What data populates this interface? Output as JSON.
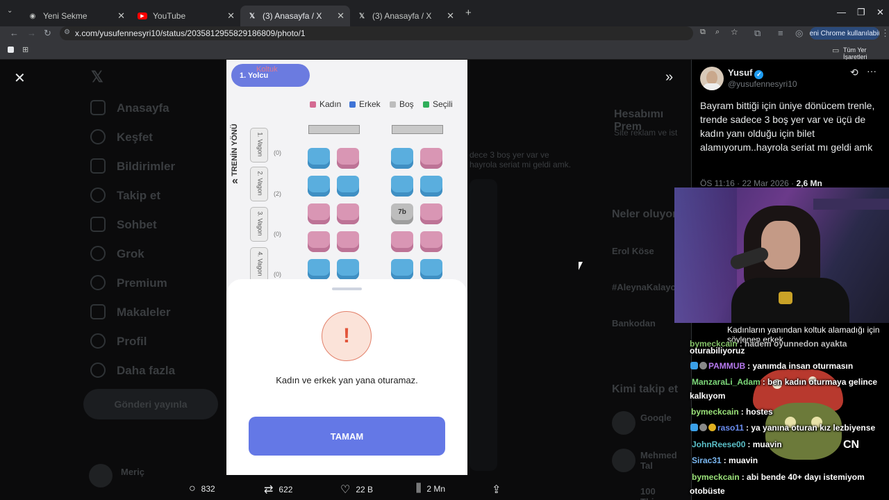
{
  "browser": {
    "tabs": [
      {
        "label": "Yeni Sekme",
        "active": false
      },
      {
        "label": "YouTube",
        "active": false
      },
      {
        "label": "(3) Anasayfa / X",
        "active": true
      },
      {
        "label": "(3) Anasayfa / X",
        "active": false
      }
    ],
    "url": "x.com/yusufennesyri10/status/2035812955829186809/photo/1",
    "chrome_button": "Yeni Chrome kullanılabilir",
    "bookmarks_label": "Tüm Yer İşaretleri"
  },
  "x_sidebar": {
    "items": [
      "Anasayfa",
      "Keşfet",
      "Bildirimler",
      "Takip et",
      "Sohbet",
      "Grok",
      "Premium",
      "Makaleler",
      "Profil",
      "Daha fazla"
    ],
    "post_button": "Gönderi yayınla",
    "account_name": "Meriç"
  },
  "x_background": {
    "premium_title": "Hesabımı Prem",
    "premium_sub": "Site reklam ve ist",
    "trends_title": "Neler oluyor",
    "trend1": "Erol Köse",
    "trend2": "#AleynaKalayc",
    "trend3": "Bankodan",
    "follow_title": "Kimi takip et",
    "follow1": "Gooqle",
    "follow2": "Mehmed Tal",
    "follow3": "100 Thieves",
    "bg_tweet": "dece 3 boş yer var ve hayrola seriat mi geldi amk."
  },
  "screenshot": {
    "passenger": "1. Yolcu",
    "seat_hint": "Koltuk",
    "legend": [
      {
        "label": "Kadın",
        "color": "#d46a92"
      },
      {
        "label": "Erkek",
        "color": "#3f74d6"
      },
      {
        "label": "Boş",
        "color": "#bdbdbd"
      },
      {
        "label": "Seçili",
        "color": "#2fae5a"
      }
    ],
    "direction": "TRENİN YÖNÜ",
    "wagons": [
      {
        "label": "1. Vagon",
        "count": "(0)"
      },
      {
        "label": "2. Vagon",
        "count": "(2)"
      },
      {
        "label": "3. Vagon",
        "count": "(0)"
      },
      {
        "label": "4. Vagon",
        "count": "(0)"
      }
    ],
    "selected_seat": "7b",
    "warning_symbol": "!",
    "warning_message": "Kadın ve erkek yan yana oturamaz.",
    "ok_button": "TAMAM"
  },
  "tweet_actions": {
    "replies": "832",
    "reposts": "622",
    "likes": "22 B",
    "views": "2 Mn"
  },
  "tweet": {
    "name": "Yusuf",
    "handle": "@yusufennesyri10",
    "text": "Bayram bittiği için üniye dönücem trenle, trende sadece 3 boş yer var ve üçü de kadın yanı olduğu için bilet alamıyorum..hayrola seriat mı geldi amk",
    "time": "ÖS 11:16 · 22 Mar 2026 · ",
    "views": "2,6 Mn",
    "verified_color": "#1d9bf0"
  },
  "stream": {
    "caption": "Kadınların yanından koltuk alamadığı için söylenen erkek",
    "chat": [
      {
        "user": "bymeckcain",
        "color": "#9be37a",
        "msg": ": hadem oyunnedon ayakta"
      },
      {
        "user": "",
        "color": "#ffffff",
        "msg": "oturabiliyoruz"
      },
      {
        "user": "PAMMUB",
        "color": "#b77af0",
        "msg": ": yanımda insan oturmasın"
      },
      {
        "user": "ManzaraLi_Adam",
        "color": "#7dd97a",
        "msg": ": ben kadın oturmaya gelince"
      },
      {
        "user": "",
        "color": "#ffffff",
        "msg": "kalkıyom"
      },
      {
        "user": "bymeckcain",
        "color": "#9be37a",
        "msg": ": hostes"
      },
      {
        "user": "raso11",
        "color": "#6a8df0",
        "msg": ": ya yanına oturan kız lezbiyense"
      },
      {
        "user": "JohnReese00",
        "color": "#5bc0c9",
        "msg": ": muavin"
      },
      {
        "user": "Sirac31",
        "color": "#7ab7f0",
        "msg": ": muavin"
      },
      {
        "user": "bymeckcain",
        "color": "#9be37a",
        "msg": ": abi bende 40+ dayı istemiyom"
      },
      {
        "user": "",
        "color": "#ffffff",
        "msg": "otobüste"
      }
    ],
    "cn_logo": "CN"
  }
}
